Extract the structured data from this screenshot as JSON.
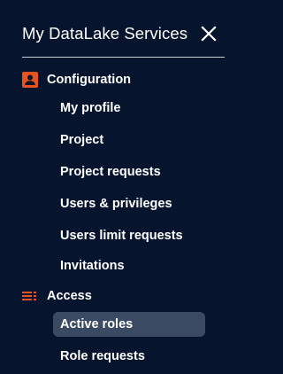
{
  "app": {
    "title": "My DataLake Services"
  },
  "icons": {
    "close": "close-icon",
    "configuration": "account-box-icon",
    "access": "list-icon"
  },
  "colors": {
    "background": "#07142e",
    "accent": "#e8521f",
    "active_item_bg": "#3a4a62",
    "text": "#ffffff",
    "divider": "#c9ced8"
  },
  "sections": [
    {
      "label": "Configuration",
      "items": [
        {
          "label": "My profile",
          "active": false
        },
        {
          "label": "Project",
          "active": false
        },
        {
          "label": "Project requests",
          "active": false
        },
        {
          "label": "Users & privileges",
          "active": false
        },
        {
          "label": "Users limit requests",
          "active": false
        },
        {
          "label": "Invitations",
          "active": false
        }
      ]
    },
    {
      "label": "Access",
      "items": [
        {
          "label": "Active roles",
          "active": true
        },
        {
          "label": "Role requests",
          "active": false
        }
      ]
    }
  ]
}
